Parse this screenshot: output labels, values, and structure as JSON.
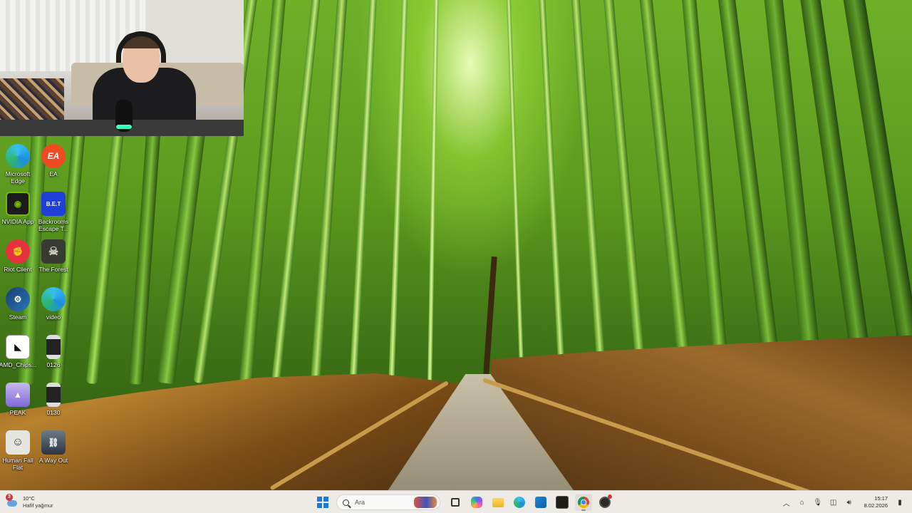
{
  "desktop": {
    "icons": [
      {
        "id": "edge",
        "label": "Microsoft Edge"
      },
      {
        "id": "ea",
        "label": "EA"
      },
      {
        "id": "nvidia",
        "label": "NVIDIA App"
      },
      {
        "id": "backrooms",
        "label": "Backrooms Escape T...",
        "icon_text": "B.E.T"
      },
      {
        "id": "riot",
        "label": "Riot Client"
      },
      {
        "id": "forest",
        "label": "The Forest"
      },
      {
        "id": "steam",
        "label": "Steam"
      },
      {
        "id": "video",
        "label": "video"
      },
      {
        "id": "amd",
        "label": "AMD_Chips..."
      },
      {
        "id": "f0126",
        "label": "0126"
      },
      {
        "id": "peak",
        "label": "PEAK"
      },
      {
        "id": "f0130",
        "label": "0130"
      },
      {
        "id": "humanfall",
        "label": "Human Fall Flat"
      },
      {
        "id": "wayout",
        "label": "A Way Out"
      }
    ]
  },
  "taskbar": {
    "weather": {
      "temperature": "10°C",
      "condition": "Hafif yağmur",
      "badge": "3",
      "icon": "cloud-rain-icon"
    },
    "search": {
      "placeholder": "Ara"
    },
    "apps": [
      {
        "name": "start",
        "icon": "windows-start-icon"
      },
      {
        "name": "task-view",
        "icon": "task-view-icon"
      },
      {
        "name": "copilot",
        "icon": "copilot-icon"
      },
      {
        "name": "file-explorer",
        "icon": "folder-icon"
      },
      {
        "name": "edge",
        "icon": "edge-icon"
      },
      {
        "name": "microsoft-store",
        "icon": "store-icon"
      },
      {
        "name": "app-dark",
        "icon": "app-icon"
      },
      {
        "name": "chrome",
        "icon": "chrome-icon",
        "running": true
      },
      {
        "name": "obs",
        "icon": "obs-icon",
        "notification": true
      }
    ],
    "tray": {
      "icons": [
        "chevron-up-icon",
        "network-icon",
        "microphone-icon",
        "wifi-icon",
        "volume-icon"
      ],
      "time": "15:17",
      "date": "8.02.2026"
    }
  },
  "colors": {
    "taskbar_bg": "#eeebe6",
    "accent": "#1d79d6",
    "badge": "#d13438"
  }
}
